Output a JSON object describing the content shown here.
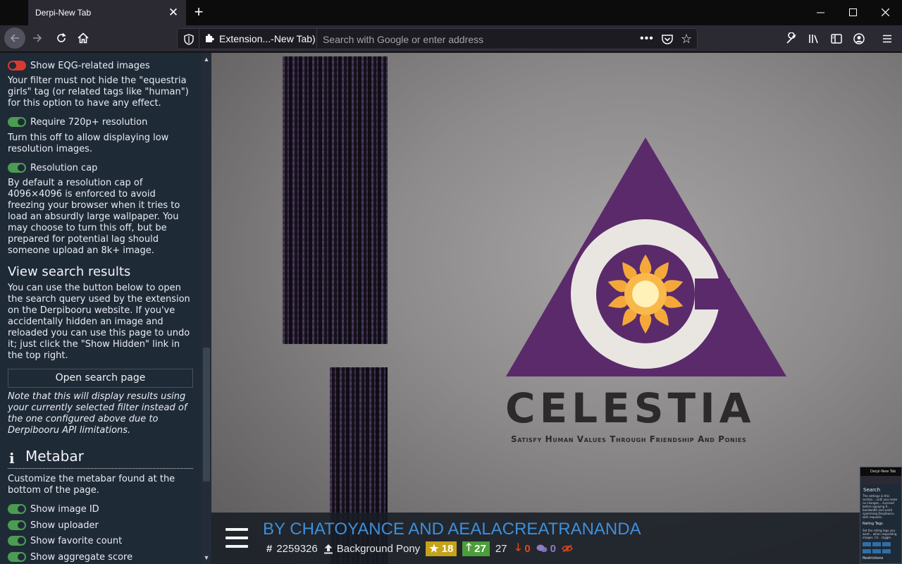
{
  "browser": {
    "tab_title": "Derpi-New Tab",
    "tab_close": "✕",
    "new_tab": "+",
    "url_extension_label": "Extension...-New Tab)",
    "url_placeholder": "Search with Google or enter address",
    "url_more": "•••"
  },
  "sidebar": {
    "toggle_eqg": "Show EQG-related images",
    "eqg_desc": "Your filter must not hide the \"equestria girls\" tag (or related tags like \"human\") for this option to have any effect.",
    "toggle_720": "Require 720p+ resolution",
    "res_desc": "Turn this off to allow displaying low resolution images.",
    "toggle_cap": "Resolution cap",
    "cap_desc": "By default a resolution cap of 4096×4096 is enforced to avoid freezing your browser when it tries to load an absurdly large wallpaper. You may choose to turn this off, but be prepared for potential lag should someone upload an 8k+ image.",
    "view_heading": "View search results",
    "view_desc": "You can use the button below to open the search query used by the extension on the Derpibooru website. If you've accidentally hidden an image and reloaded you can use this page to undo it; just click the \"Show Hidden\" link in the top right.",
    "open_button": "Open search page",
    "note": "Note that this will display results using your currently selected filter instead of the one configured above due to Derpibooru API limitations.",
    "metabar_heading": "Metabar",
    "metabar_info": "i",
    "metabar_desc": "Customize the metabar found at the bottom of the page.",
    "toggle_id": "Show image ID",
    "toggle_uploader": "Show uploader",
    "toggle_fav": "Show favorite count",
    "toggle_score": "Show aggregate score",
    "toggle_states": {
      "eqg": false,
      "res720": true,
      "cap": true,
      "id": true,
      "uploader": true,
      "fav": true,
      "score": true
    }
  },
  "wallpaper": {
    "word": "CELESTIA",
    "tagline": "Satisfy Human Values Through Friendship And Ponies",
    "colors": {
      "triangle": "#5b2a6b",
      "circle": "#e9e6e2",
      "sun": "#f5a83a"
    }
  },
  "metabar": {
    "artist": "BY CHATOYANCE AND AEALACREATRANANDA",
    "image_id": "2259326",
    "hash": "#",
    "uploader": "Background Pony",
    "favorites": "18",
    "upvotes": "27",
    "score": "27",
    "downvotes": "0",
    "comments": "0"
  },
  "mini_preview": {
    "tab": "Derpi-New Tab",
    "search": "Search",
    "text": "The settings in this section... until you make no changes... succeed before applying fi... bandwidth and avoid spamming Derpibooru with requests.",
    "rating_heading": "Rating Tags",
    "rating_text": "Set the rating tags you want... when requesting images. Cli... toggle.",
    "restrictions": "Restrictions"
  }
}
